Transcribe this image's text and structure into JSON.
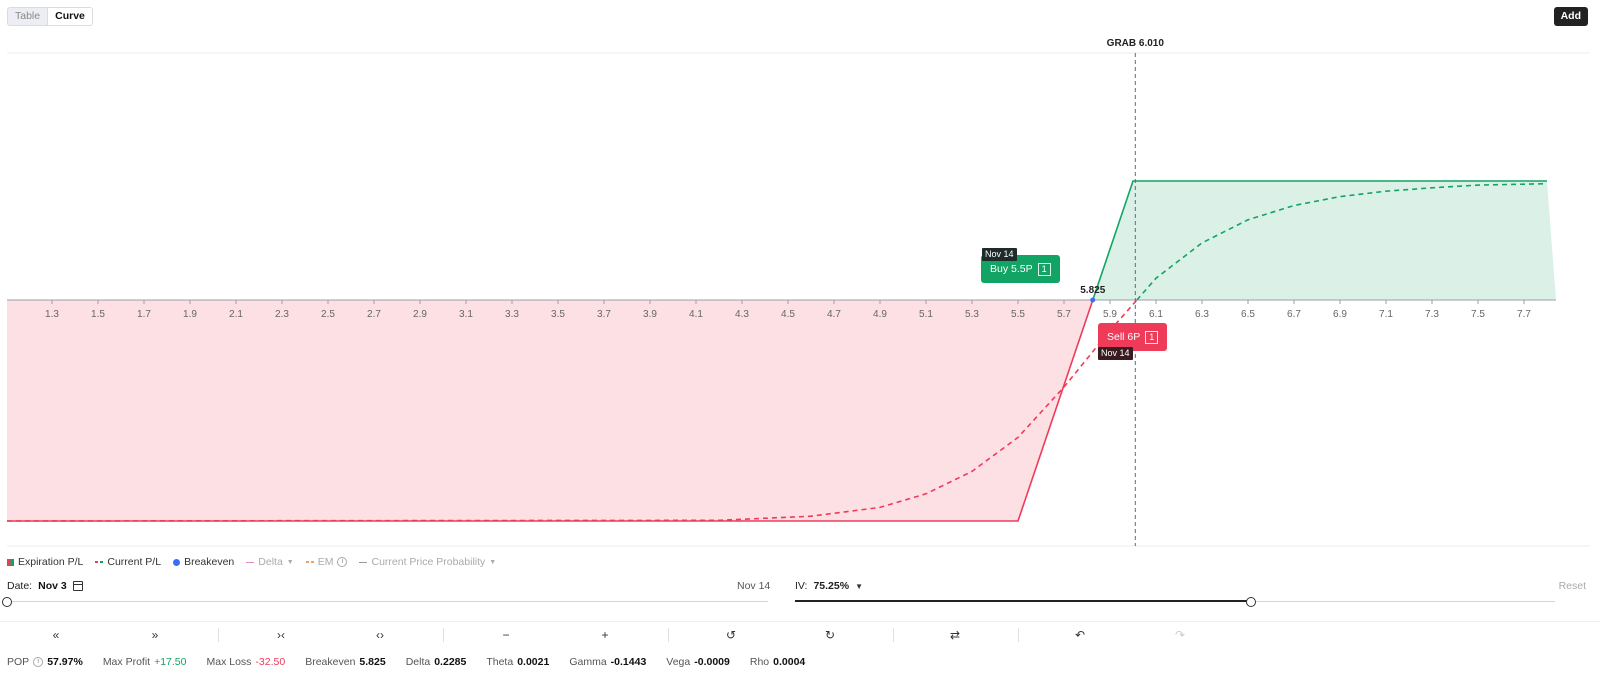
{
  "view_toggle": {
    "table_label": "Table",
    "curve_label": "Curve",
    "active": "Curve"
  },
  "add_label": "Add",
  "chart_data": {
    "type": "line",
    "underlying": "GRAB",
    "current_price": 6.01,
    "current_price_label": "GRAB 6.010",
    "breakeven": 5.825,
    "breakeven_label": "5.825",
    "xlim": [
      1.1,
      7.8
    ],
    "x_ticks": [
      "1.3",
      "1.5",
      "1.7",
      "1.9",
      "2.1",
      "2.3",
      "2.5",
      "2.7",
      "2.9",
      "3.1",
      "3.3",
      "3.5",
      "3.7",
      "3.9",
      "4.1",
      "4.3",
      "4.5",
      "4.7",
      "4.9",
      "5.1",
      "5.3",
      "5.5",
      "5.7",
      "5.9",
      "6.1",
      "6.3",
      "6.5",
      "6.7",
      "6.9",
      "7.1",
      "7.3",
      "7.5",
      "7.7"
    ],
    "ylim": [
      -37,
      37
    ],
    "series": [
      {
        "name": "Expiration P/L",
        "style": "solid",
        "points": [
          [
            1.1,
            -32.5
          ],
          [
            5.5,
            -32.5
          ],
          [
            6.0,
            17.5
          ],
          [
            7.8,
            17.5
          ]
        ]
      },
      {
        "name": "Current P/L",
        "style": "dashed",
        "points": [
          [
            1.1,
            -32.5
          ],
          [
            4.2,
            -32.4
          ],
          [
            4.6,
            -31.8
          ],
          [
            4.9,
            -30.5
          ],
          [
            5.1,
            -28.5
          ],
          [
            5.3,
            -25.2
          ],
          [
            5.5,
            -20.2
          ],
          [
            5.7,
            -12.8
          ],
          [
            5.9,
            -4.5
          ],
          [
            6.1,
            3.2
          ],
          [
            6.3,
            8.4
          ],
          [
            6.5,
            11.8
          ],
          [
            6.7,
            13.9
          ],
          [
            6.9,
            15.2
          ],
          [
            7.1,
            16.0
          ],
          [
            7.3,
            16.5
          ],
          [
            7.5,
            16.9
          ],
          [
            7.8,
            17.1
          ]
        ]
      }
    ],
    "legs": [
      {
        "label": "Buy 5.5P",
        "qty": "1",
        "date": "Nov 14",
        "strike": 5.5,
        "side": "buy"
      },
      {
        "label": "Sell 6P",
        "qty": "1",
        "date": "Nov 14",
        "strike": 6.0,
        "side": "sell"
      }
    ],
    "colors": {
      "profit": "#12a464",
      "loss": "#ef3b5a",
      "profit_fill": "#dbf1e7",
      "loss_fill": "#fde0e4",
      "breakeven": "#3b6ff2"
    }
  },
  "legend": {
    "expiration": "Expiration P/L",
    "current": "Current P/L",
    "breakeven": "Breakeven",
    "delta": "Delta",
    "em": "EM",
    "probability": "Current Price Probability"
  },
  "date_control": {
    "label": "Date:",
    "value": "Nov 3",
    "end": "Nov 14",
    "position": 0.0
  },
  "iv_control": {
    "label": "IV:",
    "value": "75.25%",
    "reset": "Reset",
    "position": 0.6
  },
  "stats": {
    "pop_label": "POP",
    "pop": "57.97%",
    "max_profit_label": "Max Profit",
    "max_profit": "+17.50",
    "max_loss_label": "Max Loss",
    "max_loss": "-32.50",
    "breakeven_label": "Breakeven",
    "breakeven": "5.825",
    "delta_label": "Delta",
    "delta": "0.2285",
    "theta_label": "Theta",
    "theta": "0.0021",
    "gamma_label": "Gamma",
    "gamma": "-0.1443",
    "vega_label": "Vega",
    "vega": "-0.0009",
    "rho_label": "Rho",
    "rho": "0.0004"
  },
  "toolbar_icons": [
    "double-left-icon",
    "double-right-icon",
    "collapse-icon",
    "expand-icon",
    "minus-icon",
    "plus-icon",
    "history-back-icon",
    "history-forward-icon",
    "swap-icon",
    "undo-icon",
    "redo-icon"
  ]
}
